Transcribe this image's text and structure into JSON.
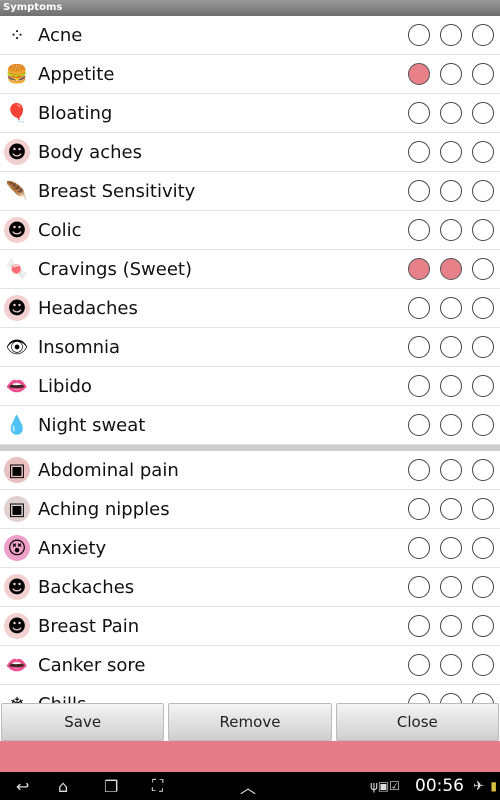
{
  "title": "Symptoms",
  "colors": {
    "selected": "#e8808a",
    "footer": "#e67c87"
  },
  "groups": [
    [
      {
        "label": "Acne",
        "icon": "acne-icon",
        "glyph": "⁘",
        "bg": "#fff",
        "level": 0
      },
      {
        "label": "Appetite",
        "icon": "burger-icon",
        "glyph": "🍔",
        "bg": "#fff",
        "level": 1
      },
      {
        "label": "Bloating",
        "icon": "balloon-icon",
        "glyph": "🎈",
        "bg": "#fff",
        "level": 0
      },
      {
        "label": "Body aches",
        "icon": "body-icon",
        "glyph": "☻",
        "bg": "#f3d0d0",
        "level": 0
      },
      {
        "label": "Breast Sensitivity",
        "icon": "feather-icon",
        "glyph": "🪶",
        "bg": "#fff",
        "level": 0
      },
      {
        "label": "Colic",
        "icon": "body-icon",
        "glyph": "☻",
        "bg": "#f3d0d0",
        "level": 0
      },
      {
        "label": "Cravings (Sweet)",
        "icon": "candy-icon",
        "glyph": "🍬",
        "bg": "#fff",
        "level": 2
      },
      {
        "label": "Headaches",
        "icon": "head-icon",
        "glyph": "☻",
        "bg": "#f3d0d0",
        "level": 0
      },
      {
        "label": "Insomnia",
        "icon": "eye-icon",
        "glyph": "👁",
        "bg": "#fff",
        "level": 0
      },
      {
        "label": "Libido",
        "icon": "lips-icon",
        "glyph": "👄",
        "bg": "#fff",
        "level": 0
      },
      {
        "label": "Night sweat",
        "icon": "droplets-icon",
        "glyph": "💧",
        "bg": "#fff",
        "level": 0
      }
    ],
    [
      {
        "label": "Abdominal pain",
        "icon": "abdomen-icon",
        "glyph": "▣",
        "bg": "#e8c0c0",
        "level": 0
      },
      {
        "label": "Aching nipples",
        "icon": "chest-icon",
        "glyph": "▣",
        "bg": "#e0d0d0",
        "level": 0
      },
      {
        "label": "Anxiety",
        "icon": "anxious-face-icon",
        "glyph": "😵",
        "bg": "#f0a0c8",
        "level": 0
      },
      {
        "label": "Backaches",
        "icon": "back-icon",
        "glyph": "☻",
        "bg": "#f3d0d0",
        "level": 0
      },
      {
        "label": "Breast Pain",
        "icon": "body-icon",
        "glyph": "☻",
        "bg": "#f3d0d0",
        "level": 0
      },
      {
        "label": "Canker sore",
        "icon": "mouth-icon",
        "glyph": "👄",
        "bg": "#fff",
        "level": 0
      },
      {
        "label": "Chills",
        "icon": "snowflake-icon",
        "glyph": "❄",
        "bg": "#fff",
        "level": 0
      }
    ]
  ],
  "buttons": {
    "save": "Save",
    "remove": "Remove",
    "close": "Close"
  },
  "status": {
    "time": "00:56"
  }
}
